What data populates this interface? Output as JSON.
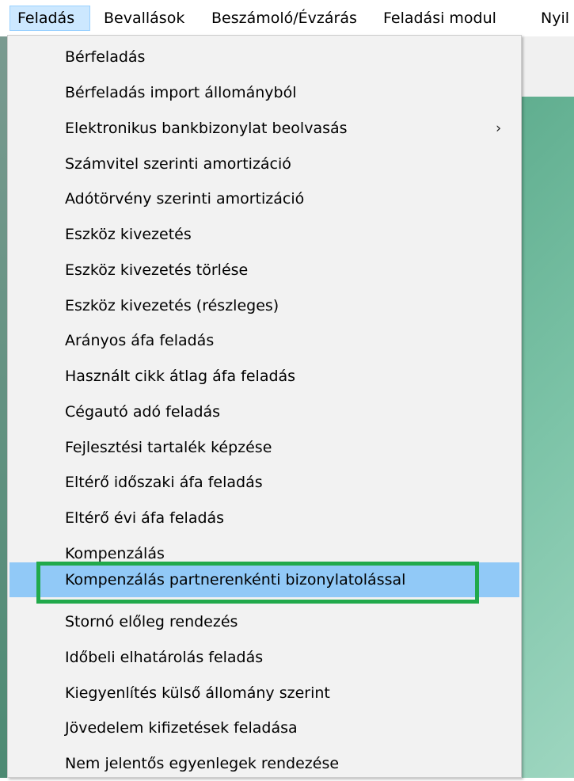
{
  "menubar": {
    "items": [
      {
        "label": "Feladás",
        "active": true
      },
      {
        "label": "Bevallások"
      },
      {
        "label": "Beszámoló/Évzárás"
      },
      {
        "label": "Feladási modul"
      },
      {
        "label": "Nyil"
      }
    ]
  },
  "dropdown": {
    "items": [
      {
        "label": "Bérfeladás"
      },
      {
        "label": "Bérfeladás import állományból"
      },
      {
        "label": "Elektronikus bankbizonylat beolvasás",
        "submenu_arrow": "›"
      },
      {
        "label": "Számvitel szerinti amortizáció"
      },
      {
        "label": "Adótörvény szerinti amortizáció"
      },
      {
        "label": "Eszköz kivezetés"
      },
      {
        "label": "Eszköz kivezetés törlése"
      },
      {
        "label": "Eszköz kivezetés (részleges)"
      },
      {
        "label": "Arányos áfa feladás"
      },
      {
        "label": "Használt cikk átlag áfa feladás"
      },
      {
        "label": "Cégautó adó feladás"
      },
      {
        "label": "Fejlesztési tartalék képzése"
      },
      {
        "label": "Eltérő időszaki áfa feladás"
      },
      {
        "label": "Eltérő évi áfa feladás"
      },
      {
        "label": "Kompenzálás"
      },
      {
        "label": "Kompenzálás partnerenkénti bizonylatolással",
        "hovered": true,
        "highlighted": true
      },
      {
        "label": "Stornó előleg rendezés"
      },
      {
        "label": "Időbeli elhatárolás feladás"
      },
      {
        "label": "Kiegyenlítés külső állomány szerint"
      },
      {
        "label": "Jövedelem kifizetések feladása"
      },
      {
        "label": "Nem jelentős egyenlegek rendezése"
      }
    ]
  },
  "colors": {
    "hover": "#91c9f7",
    "highlight_border": "#21a94b",
    "menubar_active": "#cce8ff"
  }
}
